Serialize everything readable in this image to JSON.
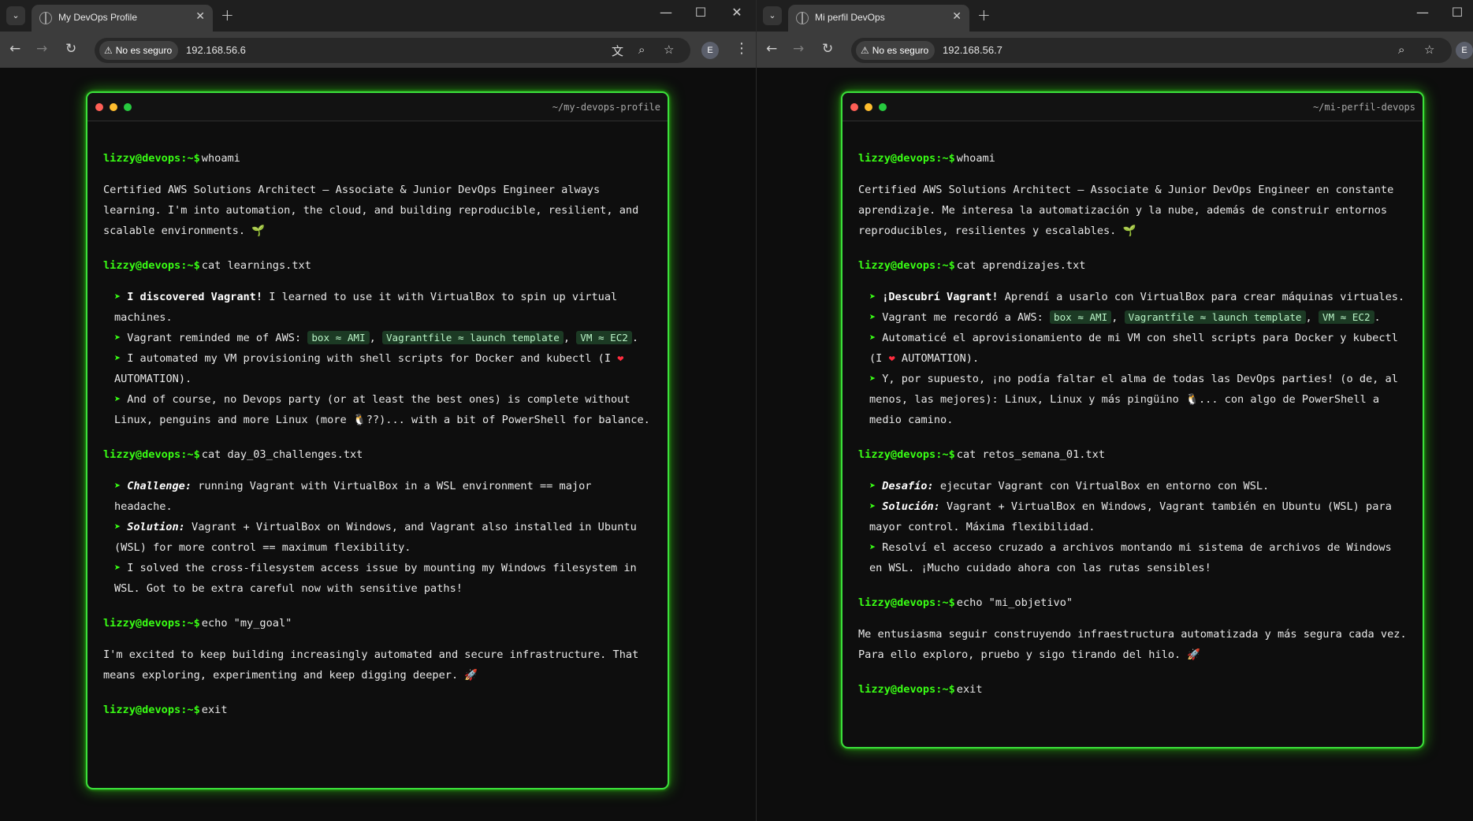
{
  "left": {
    "tab_title": "My DevOps Profile",
    "security_label": "No es seguro",
    "url": "192.168.56.6",
    "profile_initial": "E",
    "terminal_path": "~/my-devops-profile",
    "prompt": "lizzy@devops:~$",
    "cmd_whoami": "whoami",
    "whoami_output": "Certified AWS Solutions Architect – Associate & Junior DevOps Engineer always learning. I'm into automation, the cloud, and building reproducible, resilient, and scalable environments. 🌱",
    "cmd_learnings": "cat learnings.txt",
    "learnings": {
      "l1_bold": "I discovered Vagrant!",
      "l1_text": " I learned to use it with VirtualBox to spin up virtual machines.",
      "l2_text": "Vagrant reminded me of AWS: ",
      "l2_code1": "box ≈ AMI",
      "l2_sep1": ", ",
      "l2_code2": "Vagrantfile ≈ launch template",
      "l2_sep2": ", ",
      "l2_code3": "VM ≈ EC2",
      "l2_end": ".",
      "l3_text": "I automated my VM provisioning with shell scripts for Docker and kubectl (I ",
      "l3_heart": "❤",
      "l3_end": " AUTOMATION).",
      "l4_text": "And of course, no Devops party (or at least the best ones) is complete without Linux, penguins and more Linux (more 🐧??)... with a bit of PowerShell for balance."
    },
    "cmd_challenges": "cat day_03_challenges.txt",
    "challenges": {
      "c1_bold": "Challenge:",
      "c1_text": " running Vagrant with VirtualBox in a WSL environment == major headache.",
      "c2_bold": "Solution:",
      "c2_text": " Vagrant + VirtualBox on Windows, and Vagrant also installed in Ubuntu (WSL) for more control == maximum flexibility.",
      "c3_text": "I solved the cross-filesystem access issue by mounting my Windows filesystem in WSL. Got to be extra careful now with sensitive paths!"
    },
    "cmd_goal": "echo \"my_goal\"",
    "goal_output": "I'm excited to keep building increasingly automated and secure infrastructure. That means exploring, experimenting and keep digging deeper. 🚀",
    "cmd_exit": "exit"
  },
  "right": {
    "tab_title": "Mi perfil DevOps",
    "security_label": "No es seguro",
    "url": "192.168.56.7",
    "profile_initial": "E",
    "terminal_path": "~/mi-perfil-devops",
    "prompt": "lizzy@devops:~$",
    "cmd_whoami": "whoami",
    "whoami_output": "Certified AWS Solutions Architect – Associate & Junior DevOps Engineer en constante aprendizaje. Me interesa la automatización y la nube, además de construir entornos reproducibles, resilientes y escalables. 🌱",
    "cmd_learnings": "cat aprendizajes.txt",
    "learnings": {
      "l1_bold": "¡Descubrí Vagrant!",
      "l1_text": " Aprendí a usarlo con VirtualBox para crear máquinas virtuales.",
      "l2_text": "Vagrant me recordó a AWS: ",
      "l2_code1": "box ≈ AMI",
      "l2_sep1": ", ",
      "l2_code2": "Vagrantfile ≈ launch template",
      "l2_sep2": ", ",
      "l2_code3": "VM ≈ EC2",
      "l2_end": ".",
      "l3_text": "Automaticé el aprovisionamiento de mi VM con shell scripts para Docker y kubectl (I ",
      "l3_heart": "❤",
      "l3_end": " AUTOMATION).",
      "l4_text": "Y, por supuesto, ¡no podía faltar el alma de todas las DevOps parties! (o de, al menos, las mejores): Linux, Linux y más pingüino 🐧... con algo de PowerShell a medio camino."
    },
    "cmd_challenges": "cat retos_semana_01.txt",
    "challenges": {
      "c1_bold": "Desafío:",
      "c1_text": " ejecutar Vagrant con VirtualBox en entorno con WSL.",
      "c2_bold": "Solución:",
      "c2_text": " Vagrant + VirtualBox en Windows, Vagrant también en Ubuntu (WSL) para mayor control. Máxima flexibilidad.",
      "c3_text": "Resolví el acceso cruzado a archivos montando mi sistema de archivos de Windows en WSL. ¡Mucho cuidado ahora con las rutas sensibles!"
    },
    "cmd_goal": "echo \"mi_objetivo\"",
    "goal_output": "Me entusiasma seguir construyendo infraestructura automatizada y más segura cada vez. Para ello exploro, pruebo y sigo tirando del hilo. 🚀",
    "cmd_exit": "exit"
  },
  "icons": {
    "arrow": "➤",
    "warning": "⚠",
    "back": "←",
    "forward": "→",
    "reload": "↻",
    "star": "☆",
    "zoom": "⌕",
    "translate": "文",
    "kebab": "⋮",
    "tab_close": "✕",
    "new_tab": "+",
    "minimize": "—",
    "maximize": "☐",
    "close": "✕",
    "tab_search": "⌄"
  },
  "colors": {
    "neon_green": "#39ff14",
    "border_green": "#3be03b",
    "terminal_bg": "#0e0e0e",
    "code_bg": "#1c3a24"
  }
}
